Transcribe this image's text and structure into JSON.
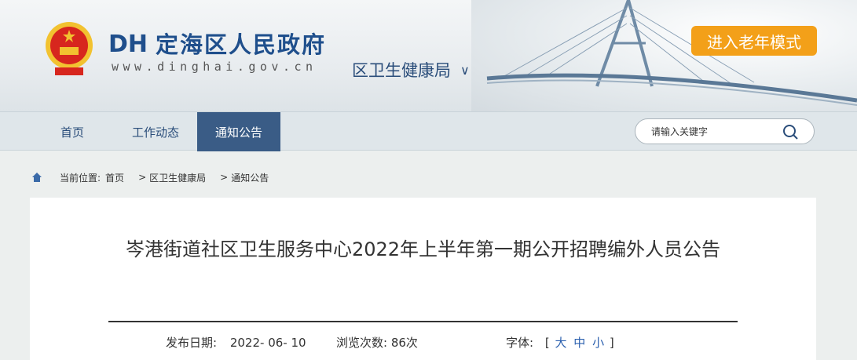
{
  "header": {
    "site_name": "定海区人民政府",
    "logo_text": "DH",
    "domain": "www.dinghai.gov.cn",
    "department": "区卫生健康局",
    "elder_mode_label": "进入老年模式"
  },
  "nav": {
    "items": [
      {
        "label": "首页"
      },
      {
        "label": "工作动态"
      },
      {
        "label": "通知公告"
      }
    ],
    "active_index": 2
  },
  "search": {
    "placeholder": "请输入关键字"
  },
  "breadcrumb": {
    "label": "当前位置:",
    "items": [
      "首页",
      "区卫生健康局",
      "通知公告"
    ],
    "separator": ">"
  },
  "article": {
    "title": "岑港街道社区卫生服务中心2022年上半年第一期公开招聘编外人员公告",
    "publish_label": "发布日期:",
    "publish_date": "2022- 06- 10",
    "views_label": "浏览次数:",
    "views_count": "86次",
    "font_label": "字体:",
    "font_open": "[",
    "font_large": "大",
    "font_medium": "中",
    "font_small": "小",
    "font_close": "]"
  },
  "colors": {
    "brand_blue": "#1f4f8c",
    "nav_active": "#3a5c86",
    "elder_button": "#f3a019"
  }
}
